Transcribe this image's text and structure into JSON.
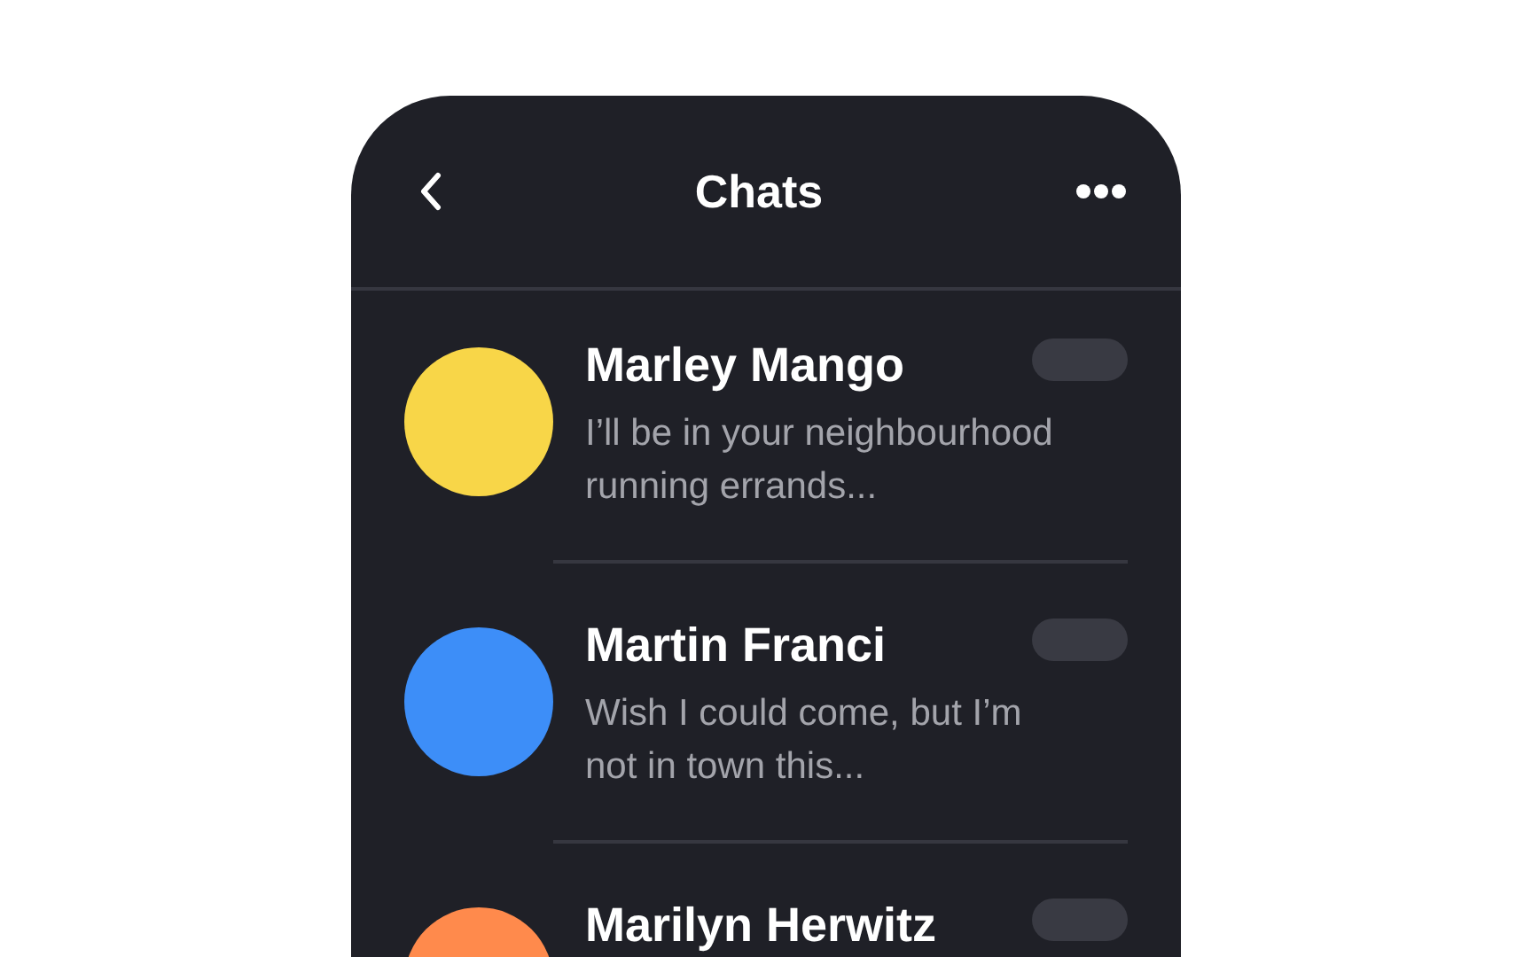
{
  "header": {
    "title": "Chats"
  },
  "chats": [
    {
      "name": "Marley Mango",
      "preview": "I’ll be in your neighbourhood running errands...",
      "color": "#f8d648"
    },
    {
      "name": "Martin Franci",
      "preview": "Wish I could come, but I’m not in town this...",
      "color": "#3d8ef8"
    },
    {
      "name": "Marilyn Herwitz",
      "color": "#ff8a4c"
    }
  ]
}
